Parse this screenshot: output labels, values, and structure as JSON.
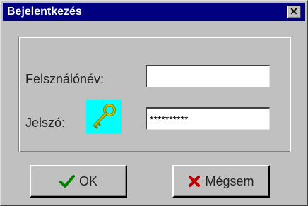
{
  "window": {
    "title": "Bejelentkezés",
    "close_glyph": "✕"
  },
  "form": {
    "username_label": "Felsználónév:",
    "username_value": "",
    "password_label": "Jelszó:",
    "password_value": "**********",
    "key_icon": "key-icon",
    "key_icon_bg": "#00ffff"
  },
  "buttons": {
    "ok_label": "OK",
    "ok_icon": "checkmark-icon",
    "ok_icon_color": "#008000",
    "cancel_label": "Mégsem",
    "cancel_icon": "x-icon",
    "cancel_icon_color": "#c00000"
  },
  "colors": {
    "titlebar": "#000080",
    "dialog_face": "#c0c0c0"
  }
}
